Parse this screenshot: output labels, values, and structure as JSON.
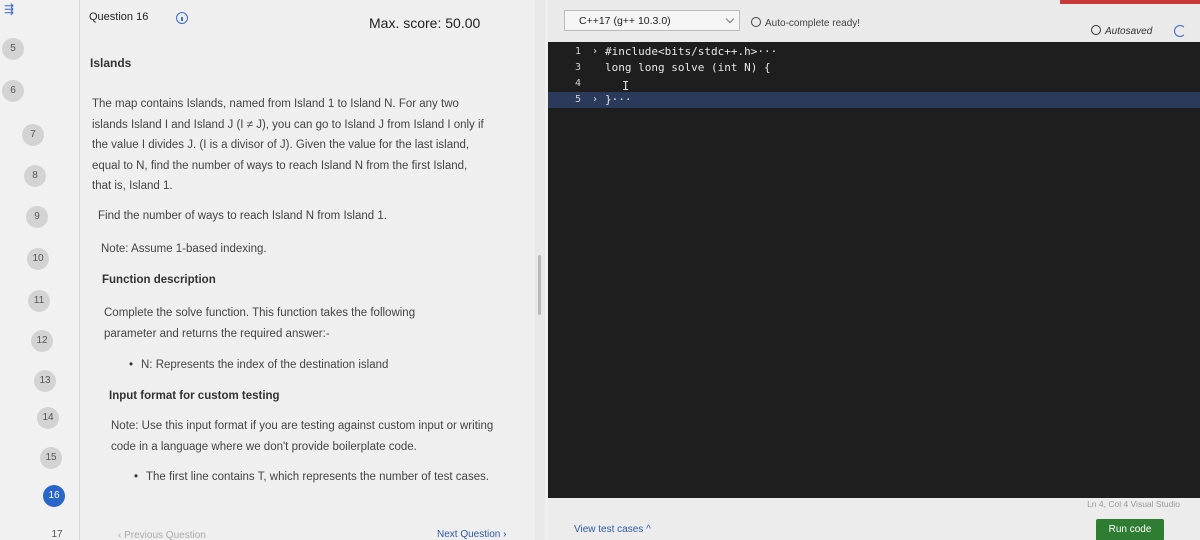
{
  "rail": {
    "menu_icon": "expand-icon",
    "question_numbers": [
      "5",
      "6",
      "7",
      "8",
      "9",
      "10",
      "11",
      "12",
      "13",
      "14",
      "15",
      "16",
      "17"
    ],
    "active": "16"
  },
  "question": {
    "label": "Question 16",
    "info_icon": "info-icon",
    "max_score": "Max. score: 50.00",
    "heading": "Islands",
    "p1": "The map contains Islands, named from Island 1 to Island N. For any two islands Island I and Island J (I ≠ J), you can go to Island J from Island I only if the value I divides J. (I is a divisor of J). Given the value for the last island, equal to N, find the number of ways to reach Island N from the first Island, that is, Island 1.",
    "p2": "Find the number of ways to reach Island N from Island 1.",
    "p3": "Note: Assume 1-based indexing.",
    "h_function": "Function description",
    "p4": "Complete the solve function. This function takes the following parameter and returns the required answer:-",
    "b1": "N: Represents the index of the destination island",
    "h_input": "Input format for custom testing",
    "p5": "Note: Use this input format if you are testing against custom input or writing code in a language where we don't provide boilerplate code.",
    "b2": "The first line contains T, which represents the number of test cases.",
    "prev": "‹ Previous Question",
    "next": "Next Question ›"
  },
  "editor": {
    "language": "C++17 (g++ 10.3.0)",
    "autocomplete": "Auto-complete ready!",
    "autosaved": "Autosaved",
    "lines": [
      {
        "n": "1",
        "fold": "›",
        "code": "#include<bits/stdc++.h>···"
      },
      {
        "n": "3",
        "fold": "",
        "code": "long long solve (int N) {"
      },
      {
        "n": "4",
        "fold": "",
        "code": ""
      },
      {
        "n": "5",
        "fold": "›",
        "code": "}···"
      }
    ],
    "status": "Ln 4, Col 4  Visual Studio",
    "view_tests": "View test cases ^",
    "run_code": "Run code"
  }
}
